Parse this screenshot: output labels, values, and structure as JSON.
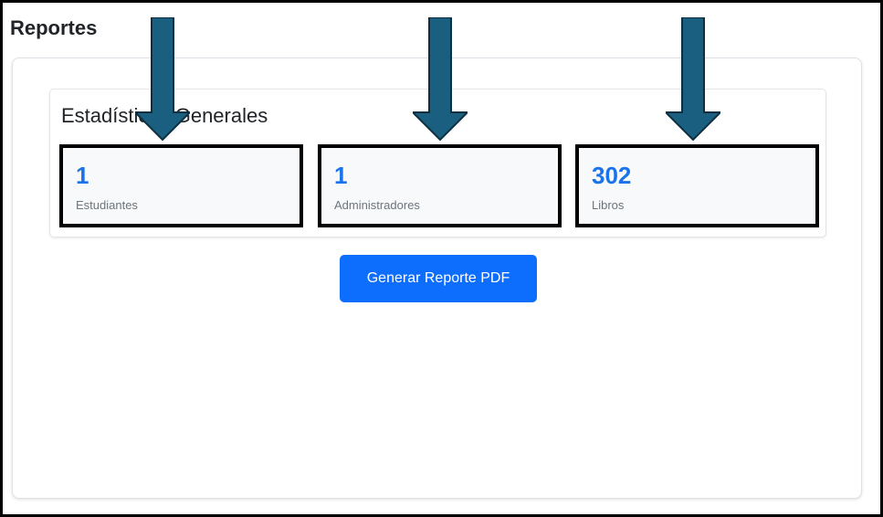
{
  "page": {
    "title": "Reportes"
  },
  "stats_section": {
    "title": "Estadísticas Generales",
    "items": [
      {
        "value": "1",
        "label": "Estudiantes"
      },
      {
        "value": "1",
        "label": "Administradores"
      },
      {
        "value": "302",
        "label": "Libros"
      }
    ]
  },
  "actions": {
    "generate_pdf_label": "Generar Reporte PDF"
  },
  "colors": {
    "accent_value": "#1a73e8",
    "button_bg": "#0d6efd",
    "annotation_arrow": "#1a5f80",
    "annotation_box": "#000000"
  },
  "annotations": {
    "arrow_icon": "down-arrow-icon",
    "count": 3
  }
}
